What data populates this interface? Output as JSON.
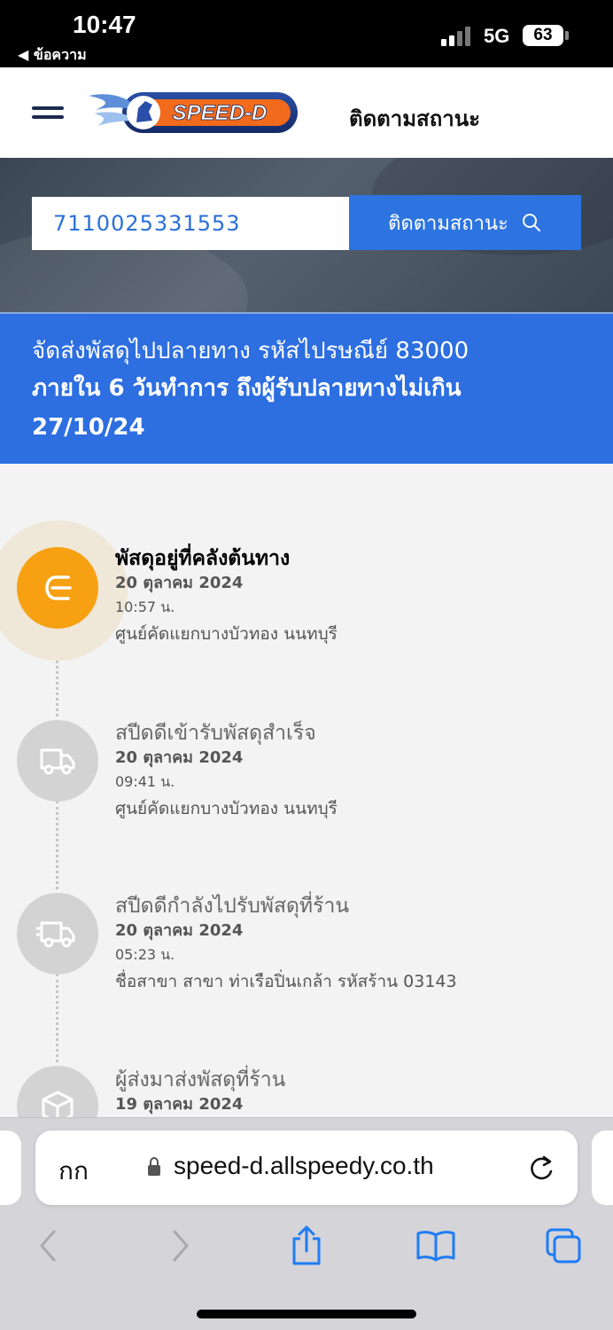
{
  "status_bar": {
    "time": "10:47",
    "back_label": "◀ ข้อความ",
    "network": "5G",
    "battery": "63"
  },
  "header": {
    "logo_text": "SPEED-D",
    "title": "ติดตามสถานะ"
  },
  "search": {
    "tracking_number": "7110025331553",
    "button_label": "ติดตามสถานะ"
  },
  "banner": {
    "line1": "จัดส่งพัสดุไปปลายทาง รหัสไปรษณีย์ 83000",
    "line2": "ภายใน 6 วันทำการ ถึงผู้รับปลายทางไม่เกิน 27/10/24"
  },
  "timeline": [
    {
      "title": "พัสดุอยู่ที่คลังต้นทาง",
      "date": "20 ตุลาคม 2024",
      "time": "10:57 น.",
      "location": "ศูนย์คัดแยกบางบัวทอง นนทบุรี",
      "icon": "arrow-left-icon",
      "active": true
    },
    {
      "title": "สปีดดีเข้ารับพัสดุสำเร็จ",
      "date": "20 ตุลาคม 2024",
      "time": "09:41 น.",
      "location": "ศูนย์คัดแยกบางบัวทอง นนทบุรี",
      "icon": "truck-icon",
      "active": false
    },
    {
      "title": "สปีดดีกำลังไปรับพัสดุที่ร้าน",
      "date": "20 ตุลาคม 2024",
      "time": "05:23 น.",
      "location": "ชื่อสาขา สาขา ท่าเรือปิ่นเกล้า รหัสร้าน 03143",
      "icon": "fast-truck-icon",
      "active": false
    },
    {
      "title": "ผู้ส่งมาส่งพัสดุที่ร้าน",
      "date": "19 ตุลาคม 2024",
      "icon": "box-icon",
      "active": false
    }
  ],
  "browser": {
    "aa_label": "กก",
    "url": "speed-d.allspeedy.co.th"
  },
  "colors": {
    "brand_blue": "#2d6ee0",
    "active_orange": "#f7a012",
    "inactive_grey": "#d3d3d3"
  }
}
